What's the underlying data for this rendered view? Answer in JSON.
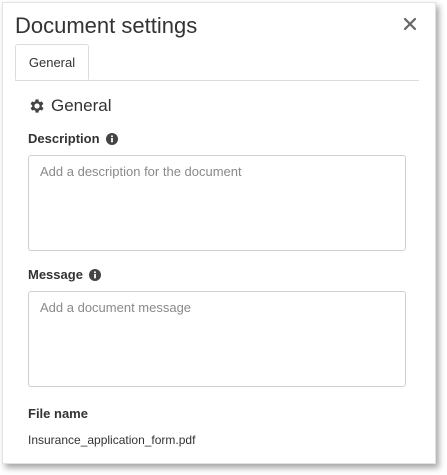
{
  "dialog": {
    "title": "Document settings",
    "close_icon": "close-icon"
  },
  "tabs": [
    {
      "label": "General",
      "active": true
    }
  ],
  "section": {
    "icon": "gear-icon",
    "heading": "General"
  },
  "fields": {
    "description": {
      "label": "Description",
      "info_icon": "info-icon",
      "value": "",
      "placeholder": "Add a description for the document"
    },
    "message": {
      "label": "Message",
      "info_icon": "info-icon",
      "value": "",
      "placeholder": "Add a document message"
    },
    "file_name": {
      "label": "File name",
      "value": "Insurance_application_form.pdf"
    }
  },
  "colors": {
    "text": "#333333",
    "border": "#cfcfcf",
    "placeholder": "#8a8a8a"
  }
}
